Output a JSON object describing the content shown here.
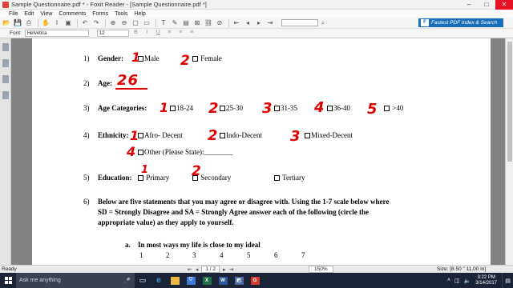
{
  "window": {
    "title": "Sample Questionnaire.pdf * - Foxit Reader - [Sample Questionnaire.pdf *]"
  },
  "menu": [
    "File",
    "Edit",
    "View",
    "Comments",
    "Forms",
    "Tools",
    "Help"
  ],
  "ad_banner": "Fastest PDF Index & Search",
  "fontbar": {
    "font_label": "Font:",
    "font_value": "Helvetica",
    "size_value": "12"
  },
  "document": {
    "q1_num": "1)",
    "q1_label": "Gender:",
    "q1_opt1": "Male",
    "q1_opt2": "Female",
    "q2_num": "2)",
    "q2_label": "Age:",
    "q3_num": "3)",
    "q3_label": "Age Categories:",
    "q3_opts": [
      "18-24",
      "25-30",
      "31-35",
      "36-40",
      ">40"
    ],
    "q4_num": "4)",
    "q4_label": "Ethnicity:",
    "q4_opts": [
      "Afro- Decent",
      "Indo-Decent",
      "Mixed-Decent"
    ],
    "q4_other": "Other (Please State):________",
    "q5_num": "5)",
    "q5_label": "Education:",
    "q5_opts": [
      "Primary",
      "Secondary",
      "Tertiary"
    ],
    "q6_num": "6)",
    "q6_text": [
      "Below are five statements that you may agree or disagree with. Using the 1-7 scale below where",
      "SD = Strongly Disagree and SA = Strongly Agree answer each of the following (circle the",
      "appropriate value) as they apply to yourself."
    ],
    "qa_num": "a.",
    "qa_text": "In most ways my life is close to my ideal",
    "scale": [
      "1",
      "2",
      "3",
      "4",
      "5",
      "6",
      "7"
    ]
  },
  "handwriting": {
    "gender": [
      "1",
      "2"
    ],
    "age": "26",
    "age_cats": [
      "1",
      "2",
      "3",
      "4",
      "5"
    ],
    "ethnicity": [
      "1",
      "2",
      "3",
      "4"
    ],
    "education": [
      "1",
      "2"
    ]
  },
  "status": {
    "ready": "Ready",
    "page": "1 / 2",
    "zoom": "150%",
    "size": "Size: [8.50 \" 11.00 in]"
  },
  "taskbar": {
    "search_placeholder": "Ask me anything",
    "time": "3:22 PM",
    "date": "3/14/2017"
  }
}
